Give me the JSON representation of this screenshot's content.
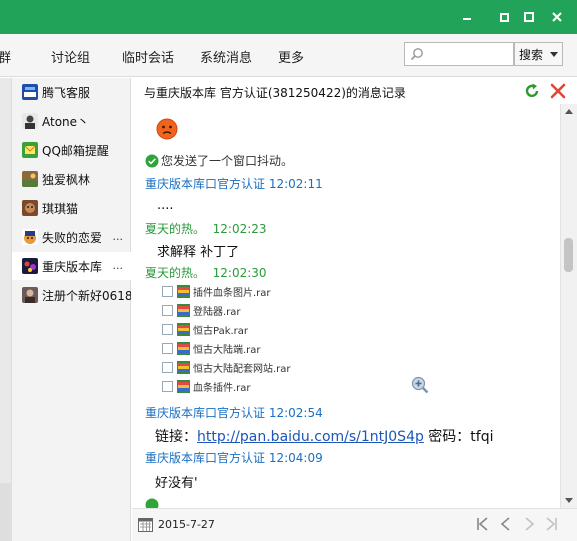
{
  "window": {
    "controls": [
      "minimize-icon",
      "maximize-icon",
      "close-icon"
    ],
    "accent_color": "#22a35a"
  },
  "nav": {
    "items": [
      {
        "label": "群"
      },
      {
        "label": "讨论组"
      },
      {
        "label": "临时会话"
      },
      {
        "label": "系统消息"
      },
      {
        "label": "更多"
      }
    ],
    "search_placeholder": "",
    "search_button": "搜索"
  },
  "sidebar": {
    "items": [
      {
        "label": "腾飞客服",
        "more": ""
      },
      {
        "label": "Atone丶",
        "more": ""
      },
      {
        "label": "QQ邮箱提醒",
        "more": ""
      },
      {
        "label": "独爱枫林",
        "more": ""
      },
      {
        "label": "琪琪猫",
        "more": ""
      },
      {
        "label": "失败的恋爱",
        "more": "..."
      },
      {
        "label": "重庆版本库",
        "more": "..."
      },
      {
        "label": "注册个新好0618",
        "more": ""
      }
    ],
    "active_index": 6
  },
  "history": {
    "title": "与重庆版本库  官方认证(381250422)的消息记录",
    "system_message": "您发送了一个窗口抖动。",
    "messages": [
      {
        "sender": "重庆版本库口官方认证",
        "time": "12:02:11",
        "text": "...."
      },
      {
        "sender": "夏天的热。",
        "time": "12:02:23",
        "text": "求解释   补丁了"
      },
      {
        "sender": "夏天的热。",
        "time": "12:02:30",
        "text": ""
      },
      {
        "sender": "重庆版本库口官方认证",
        "time": "12:02:54",
        "text_prefix": "链接：",
        "link": "http://pan.baidu.com/s/1ntJ0S4p",
        "text_suffix": " 密码：tfqi"
      },
      {
        "sender": "重庆版本库口官方认证",
        "time": "12:04:09",
        "text": "好没有'"
      }
    ],
    "files": [
      "插件血条图片.rar",
      "登陆器.rar",
      "恒古Pak.rar",
      "恒古大陆端.rar",
      "恒古大陆配套网站.rar",
      "血条插件.rar"
    ]
  },
  "footer": {
    "date": "2015-7-27"
  }
}
